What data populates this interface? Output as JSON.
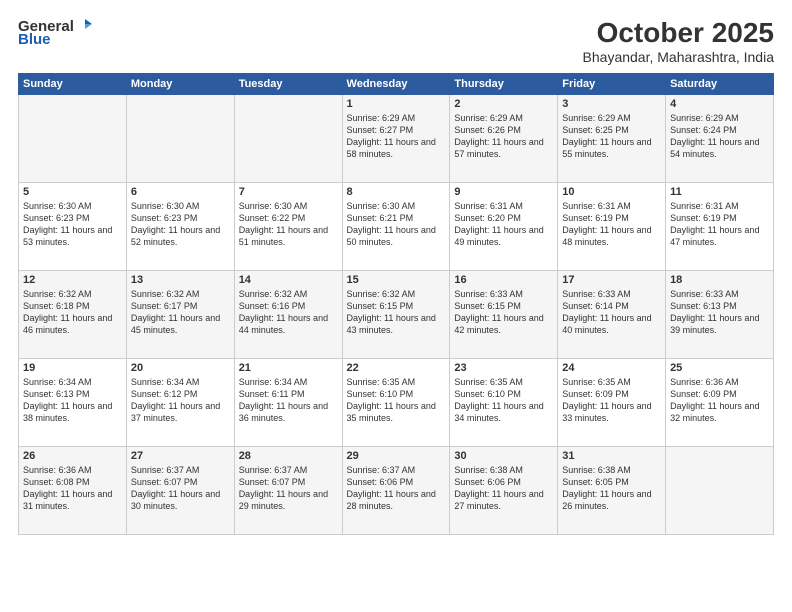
{
  "header": {
    "logo_general": "General",
    "logo_blue": "Blue",
    "month": "October 2025",
    "location": "Bhayandar, Maharashtra, India"
  },
  "weekdays": [
    "Sunday",
    "Monday",
    "Tuesday",
    "Wednesday",
    "Thursday",
    "Friday",
    "Saturday"
  ],
  "weeks": [
    [
      {
        "day": "",
        "sunrise": "",
        "sunset": "",
        "daylight": ""
      },
      {
        "day": "",
        "sunrise": "",
        "sunset": "",
        "daylight": ""
      },
      {
        "day": "",
        "sunrise": "",
        "sunset": "",
        "daylight": ""
      },
      {
        "day": "1",
        "sunrise": "Sunrise: 6:29 AM",
        "sunset": "Sunset: 6:27 PM",
        "daylight": "Daylight: 11 hours and 58 minutes."
      },
      {
        "day": "2",
        "sunrise": "Sunrise: 6:29 AM",
        "sunset": "Sunset: 6:26 PM",
        "daylight": "Daylight: 11 hours and 57 minutes."
      },
      {
        "day": "3",
        "sunrise": "Sunrise: 6:29 AM",
        "sunset": "Sunset: 6:25 PM",
        "daylight": "Daylight: 11 hours and 55 minutes."
      },
      {
        "day": "4",
        "sunrise": "Sunrise: 6:29 AM",
        "sunset": "Sunset: 6:24 PM",
        "daylight": "Daylight: 11 hours and 54 minutes."
      }
    ],
    [
      {
        "day": "5",
        "sunrise": "Sunrise: 6:30 AM",
        "sunset": "Sunset: 6:23 PM",
        "daylight": "Daylight: 11 hours and 53 minutes."
      },
      {
        "day": "6",
        "sunrise": "Sunrise: 6:30 AM",
        "sunset": "Sunset: 6:23 PM",
        "daylight": "Daylight: 11 hours and 52 minutes."
      },
      {
        "day": "7",
        "sunrise": "Sunrise: 6:30 AM",
        "sunset": "Sunset: 6:22 PM",
        "daylight": "Daylight: 11 hours and 51 minutes."
      },
      {
        "day": "8",
        "sunrise": "Sunrise: 6:30 AM",
        "sunset": "Sunset: 6:21 PM",
        "daylight": "Daylight: 11 hours and 50 minutes."
      },
      {
        "day": "9",
        "sunrise": "Sunrise: 6:31 AM",
        "sunset": "Sunset: 6:20 PM",
        "daylight": "Daylight: 11 hours and 49 minutes."
      },
      {
        "day": "10",
        "sunrise": "Sunrise: 6:31 AM",
        "sunset": "Sunset: 6:19 PM",
        "daylight": "Daylight: 11 hours and 48 minutes."
      },
      {
        "day": "11",
        "sunrise": "Sunrise: 6:31 AM",
        "sunset": "Sunset: 6:19 PM",
        "daylight": "Daylight: 11 hours and 47 minutes."
      }
    ],
    [
      {
        "day": "12",
        "sunrise": "Sunrise: 6:32 AM",
        "sunset": "Sunset: 6:18 PM",
        "daylight": "Daylight: 11 hours and 46 minutes."
      },
      {
        "day": "13",
        "sunrise": "Sunrise: 6:32 AM",
        "sunset": "Sunset: 6:17 PM",
        "daylight": "Daylight: 11 hours and 45 minutes."
      },
      {
        "day": "14",
        "sunrise": "Sunrise: 6:32 AM",
        "sunset": "Sunset: 6:16 PM",
        "daylight": "Daylight: 11 hours and 44 minutes."
      },
      {
        "day": "15",
        "sunrise": "Sunrise: 6:32 AM",
        "sunset": "Sunset: 6:15 PM",
        "daylight": "Daylight: 11 hours and 43 minutes."
      },
      {
        "day": "16",
        "sunrise": "Sunrise: 6:33 AM",
        "sunset": "Sunset: 6:15 PM",
        "daylight": "Daylight: 11 hours and 42 minutes."
      },
      {
        "day": "17",
        "sunrise": "Sunrise: 6:33 AM",
        "sunset": "Sunset: 6:14 PM",
        "daylight": "Daylight: 11 hours and 40 minutes."
      },
      {
        "day": "18",
        "sunrise": "Sunrise: 6:33 AM",
        "sunset": "Sunset: 6:13 PM",
        "daylight": "Daylight: 11 hours and 39 minutes."
      }
    ],
    [
      {
        "day": "19",
        "sunrise": "Sunrise: 6:34 AM",
        "sunset": "Sunset: 6:13 PM",
        "daylight": "Daylight: 11 hours and 38 minutes."
      },
      {
        "day": "20",
        "sunrise": "Sunrise: 6:34 AM",
        "sunset": "Sunset: 6:12 PM",
        "daylight": "Daylight: 11 hours and 37 minutes."
      },
      {
        "day": "21",
        "sunrise": "Sunrise: 6:34 AM",
        "sunset": "Sunset: 6:11 PM",
        "daylight": "Daylight: 11 hours and 36 minutes."
      },
      {
        "day": "22",
        "sunrise": "Sunrise: 6:35 AM",
        "sunset": "Sunset: 6:10 PM",
        "daylight": "Daylight: 11 hours and 35 minutes."
      },
      {
        "day": "23",
        "sunrise": "Sunrise: 6:35 AM",
        "sunset": "Sunset: 6:10 PM",
        "daylight": "Daylight: 11 hours and 34 minutes."
      },
      {
        "day": "24",
        "sunrise": "Sunrise: 6:35 AM",
        "sunset": "Sunset: 6:09 PM",
        "daylight": "Daylight: 11 hours and 33 minutes."
      },
      {
        "day": "25",
        "sunrise": "Sunrise: 6:36 AM",
        "sunset": "Sunset: 6:09 PM",
        "daylight": "Daylight: 11 hours and 32 minutes."
      }
    ],
    [
      {
        "day": "26",
        "sunrise": "Sunrise: 6:36 AM",
        "sunset": "Sunset: 6:08 PM",
        "daylight": "Daylight: 11 hours and 31 minutes."
      },
      {
        "day": "27",
        "sunrise": "Sunrise: 6:37 AM",
        "sunset": "Sunset: 6:07 PM",
        "daylight": "Daylight: 11 hours and 30 minutes."
      },
      {
        "day": "28",
        "sunrise": "Sunrise: 6:37 AM",
        "sunset": "Sunset: 6:07 PM",
        "daylight": "Daylight: 11 hours and 29 minutes."
      },
      {
        "day": "29",
        "sunrise": "Sunrise: 6:37 AM",
        "sunset": "Sunset: 6:06 PM",
        "daylight": "Daylight: 11 hours and 28 minutes."
      },
      {
        "day": "30",
        "sunrise": "Sunrise: 6:38 AM",
        "sunset": "Sunset: 6:06 PM",
        "daylight": "Daylight: 11 hours and 27 minutes."
      },
      {
        "day": "31",
        "sunrise": "Sunrise: 6:38 AM",
        "sunset": "Sunset: 6:05 PM",
        "daylight": "Daylight: 11 hours and 26 minutes."
      },
      {
        "day": "",
        "sunrise": "",
        "sunset": "",
        "daylight": ""
      }
    ]
  ]
}
